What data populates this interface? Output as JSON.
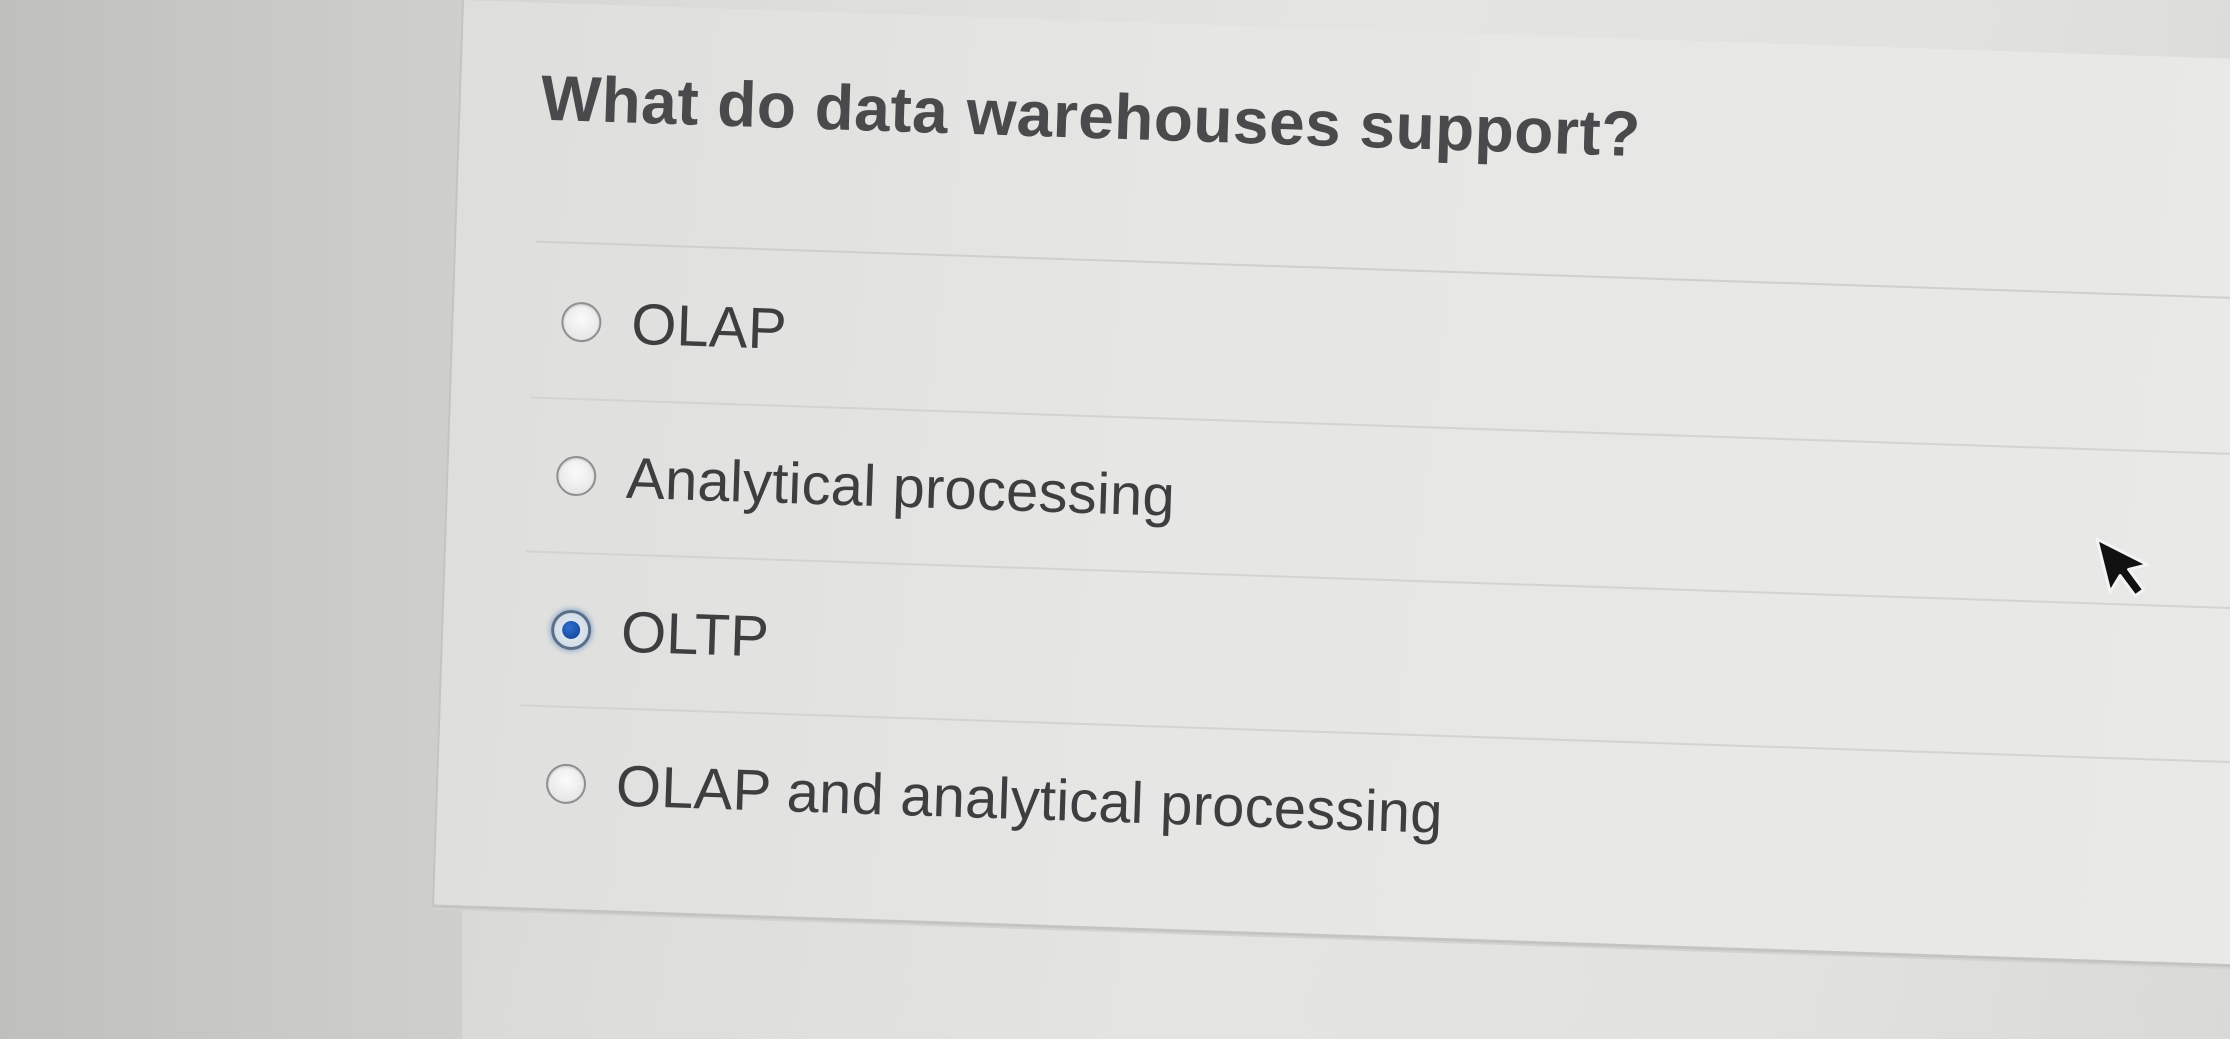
{
  "question": {
    "text": "What do data warehouses support?"
  },
  "options": [
    {
      "label": "OLAP",
      "selected": false
    },
    {
      "label": "Analytical processing",
      "selected": false
    },
    {
      "label": "OLTP",
      "selected": true
    },
    {
      "label": "OLAP and analytical processing",
      "selected": false
    }
  ],
  "colors": {
    "selected_radio": "#1f56b0",
    "text": "#3e3e40",
    "background": "#e4e4e2"
  },
  "icons": {
    "cursor": "arrow-cursor-icon",
    "radio": "radio-button-icon"
  }
}
